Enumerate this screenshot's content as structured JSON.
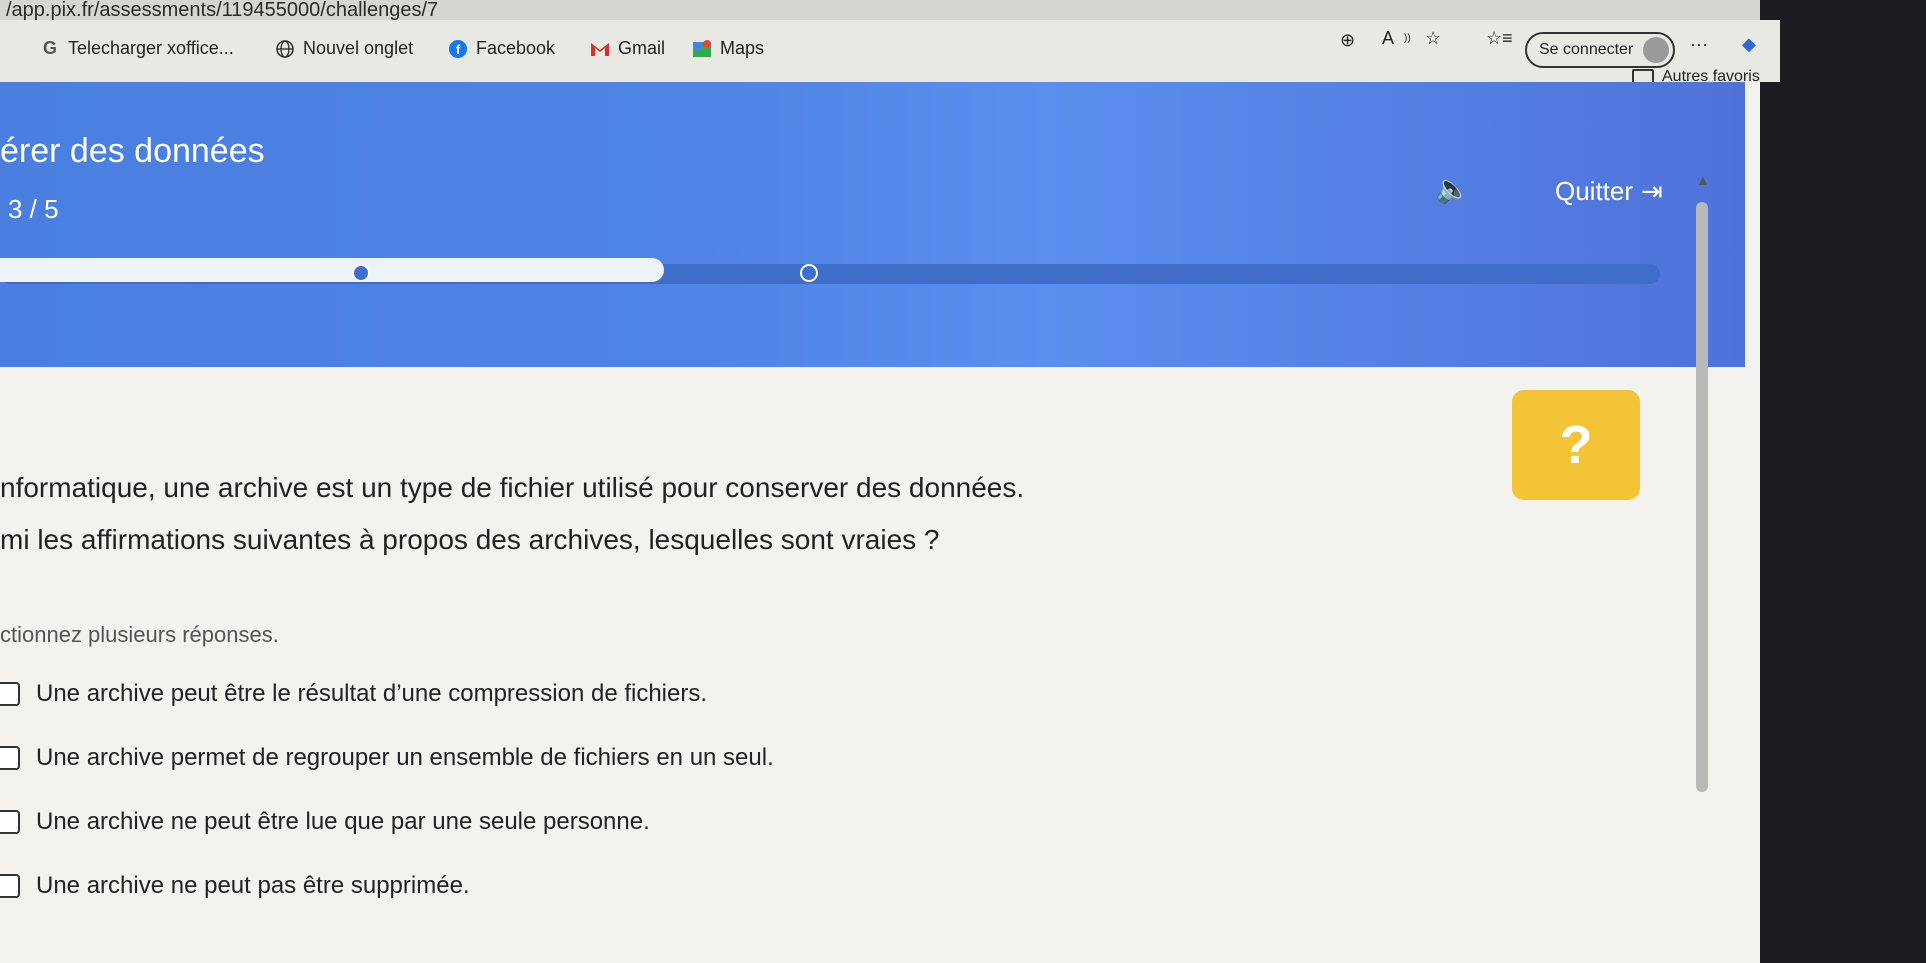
{
  "browser": {
    "url": "/app.pix.fr/assessments/119455000/challenges/7",
    "connect_label": "Se connecter",
    "other_favorites": "Autres favoris",
    "bookmarks": [
      {
        "label": "Telecharger xoffice...",
        "icon": "google-icon"
      },
      {
        "label": "Nouvel onglet",
        "icon": "globe-icon"
      },
      {
        "label": "Facebook",
        "icon": "facebook-icon"
      },
      {
        "label": "Gmail",
        "icon": "gmail-icon"
      },
      {
        "label": "Maps",
        "icon": "maps-icon"
      }
    ]
  },
  "header": {
    "title": "érer des données",
    "counter": "3 / 5",
    "quit_label": "Quitter",
    "progress": 0.4
  },
  "question": {
    "intro": "nformatique, une archive est un type de fichier utilisé pour conserver des données.",
    "prompt": "mi les affirmations suivantes à propos des archives, lesquelles sont vraies ?",
    "hint": "ctionnez plusieurs réponses."
  },
  "options": [
    "Une archive peut être le résultat d’une compression de fichiers.",
    "Une archive permet de regrouper un ensemble de fichiers en un seul.",
    "Une archive ne peut être lue que par une seule personne.",
    "Une archive ne peut pas être supprimée."
  ],
  "colors": {
    "header_blue": "#4f84e4",
    "help_yellow": "#f2c436",
    "page_bg": "#f3f2ee"
  }
}
